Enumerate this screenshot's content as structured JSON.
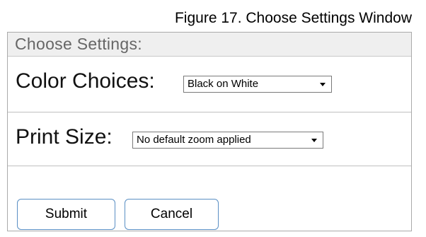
{
  "caption": "Figure 17. Choose Settings Window",
  "panel": {
    "title": "Choose Settings:",
    "color_choices": {
      "label": "Color Choices:",
      "selected": "Black on White"
    },
    "print_size": {
      "label": "Print Size:",
      "selected": "No default zoom applied"
    },
    "buttons": {
      "submit": "Submit",
      "cancel": "Cancel"
    }
  },
  "colors": {
    "header_bg": "#efefef",
    "header_text": "#666666",
    "button_border": "#5a8fc4",
    "panel_border": "#aaaaaa"
  },
  "icons": {
    "dropdown": "chevron-down-icon"
  }
}
